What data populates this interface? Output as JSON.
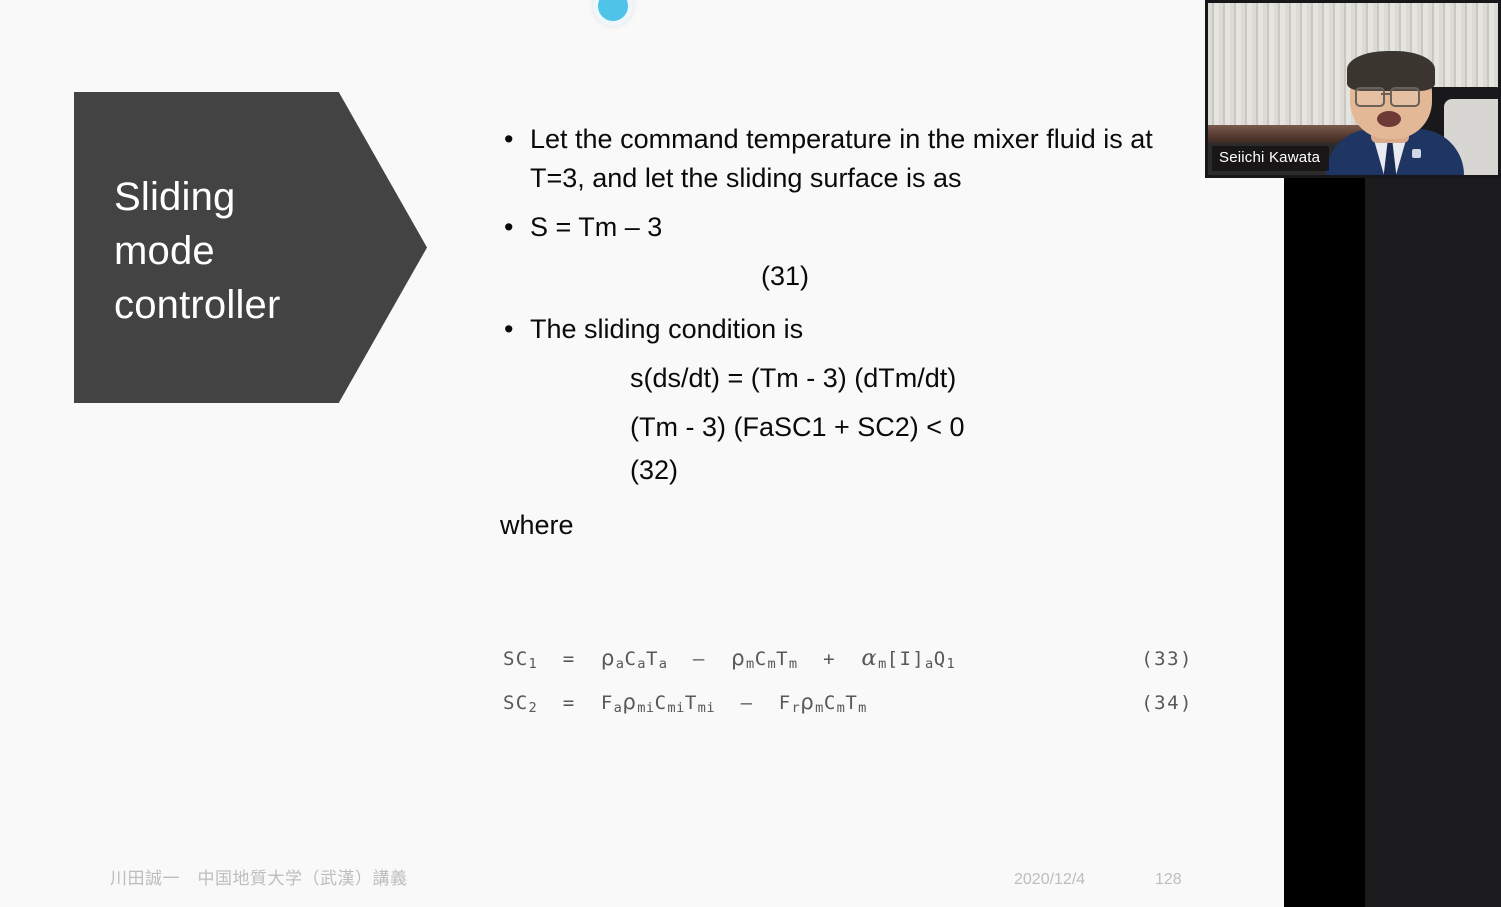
{
  "slide": {
    "title_block": {
      "text": "Sliding\nmode\ncontroller"
    },
    "bullets": [
      {
        "marker": "•",
        "text": "Let the command temperature in the mixer fluid is at T=3, and let the sliding surface is as"
      },
      {
        "marker": "•",
        "text": "S = Tm – 3"
      },
      {
        "marker": "•",
        "text": "The sliding condition is"
      }
    ],
    "eq31_number": "(31)",
    "equations": [
      "s(ds/dt) = (Tm - 3) (dTm/dt)",
      "(Tm - 3) (FaSC1 + SC2) < 0",
      "(32)"
    ],
    "where_label": "where",
    "scanned_equations": [
      {
        "lhs": "SC",
        "lhs_sub": "1",
        "body_plain": "= ρaCaTa – ρmCmTm + αm[I]aQ1",
        "number": "(33)"
      },
      {
        "lhs": "SC",
        "lhs_sub": "2",
        "body_plain": "= FaρmiCmiTmi – FrρmCmTm",
        "number": "(34)"
      }
    ],
    "footer": {
      "author_affiliation": "川田誠一　中国地質大学（武漢）講義",
      "date": "2020/12/4",
      "page_number": "128"
    },
    "colors": {
      "title_block_bg": "#434343",
      "title_block_text": "#ffffff",
      "slide_bg": "#f9f9f9",
      "body_text": "#0a0a0a",
      "footer_text": "#bdbdbd",
      "scan_text": "#585858"
    }
  },
  "video_tile": {
    "participant_name": "Seiichi Kawata"
  },
  "pointer": {
    "icon": "laser-pointer-dot",
    "color": "#4fc3e8"
  }
}
